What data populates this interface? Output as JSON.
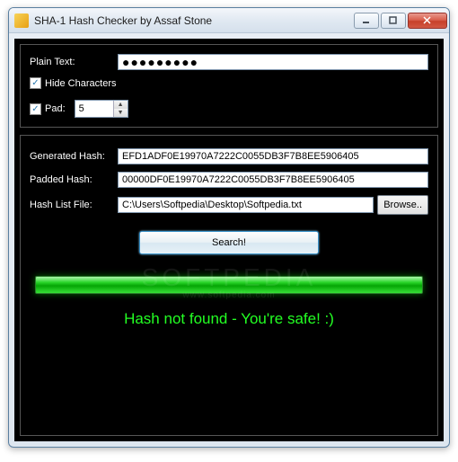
{
  "window": {
    "title": "SHA-1 Hash Checker by Assaf Stone"
  },
  "input_section": {
    "plain_text_label": "Plain Text:",
    "plain_text_value": "●●●●●●●●●",
    "hide_chars_label": "Hide Characters",
    "hide_chars_checked": "✓",
    "pad_label": "Pad:",
    "pad_checked": "✓",
    "pad_value": "5"
  },
  "output_section": {
    "generated_hash_label": "Generated Hash:",
    "generated_hash_value": "EFD1ADF0E19970A7222C0055DB3F7B8EE5906405",
    "padded_hash_label": "Padded Hash:",
    "padded_hash_value": "00000DF0E19970A7222C0055DB3F7B8EE5906405",
    "hash_list_label": "Hash List File:",
    "hash_list_value": "C:\\Users\\Softpedia\\Desktop\\Softpedia.txt",
    "browse_label": "Browse..",
    "search_label": "Search!"
  },
  "result": {
    "message": "Hash not found - You're safe! :)"
  },
  "watermark": {
    "big": "SOFTPEDIA",
    "small": "www.softpedia.com"
  }
}
